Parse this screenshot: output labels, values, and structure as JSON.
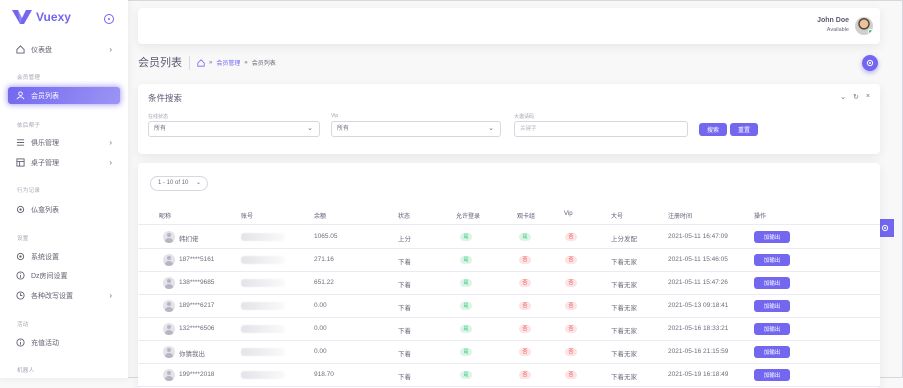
{
  "app": {
    "brand": "Vuexy",
    "accent": "#7367f0",
    "success": "#28c76f",
    "danger": "#ea5455"
  },
  "sidebar": {
    "sections": [
      "会员管理",
      "依后帮子",
      "行为记录",
      "设置",
      "活动",
      "机器人"
    ],
    "items": [
      {
        "label": "仪表盘",
        "icon": "home-icon",
        "active": false,
        "has_submenu": true
      },
      {
        "label": "会员列表",
        "icon": "user-icon",
        "active": true,
        "has_submenu": false
      },
      {
        "label": "俱乐管理",
        "icon": "list-icon",
        "active": false,
        "has_submenu": true
      },
      {
        "label": "桌子管理",
        "icon": "layout-icon",
        "active": false,
        "has_submenu": true
      },
      {
        "label": "仏龛列表",
        "icon": "settings-icon",
        "active": false,
        "has_submenu": false
      },
      {
        "label": "系统设置",
        "icon": "gear-icon",
        "active": false,
        "has_submenu": false
      },
      {
        "label": "Dz房间设置",
        "icon": "info-icon",
        "active": false,
        "has_submenu": false
      },
      {
        "label": "各种改写设置",
        "icon": "clock-icon",
        "active": false,
        "has_submenu": true
      },
      {
        "label": "充值活动",
        "icon": "info-icon",
        "active": false,
        "has_submenu": false
      }
    ]
  },
  "navbar": {
    "user_name": "John Doe",
    "user_status": "Available"
  },
  "header": {
    "title": "会员列表",
    "breadcrumb": [
      "会员管理",
      "会员列表"
    ]
  },
  "filter": {
    "title": "条件搜索",
    "fields": [
      {
        "label": "在线状态",
        "value": "所有"
      },
      {
        "label": "Vip",
        "value": "所有"
      },
      {
        "label": "大邀请码",
        "placeholder": "关键字"
      }
    ],
    "search_label": "搜索",
    "reset_label": "重置"
  },
  "table": {
    "pager": "1 - 10 of 10",
    "columns": [
      "昵称",
      "账号",
      "余额",
      "状态",
      "允许登录",
      "观卡组",
      "Vip",
      "大号",
      "注册时间",
      "操作"
    ],
    "rows": [
      {
        "nick": "韩扪佬",
        "balance": "1065.05",
        "status": "上分",
        "allow": "是",
        "allow_ok": true,
        "card": "是",
        "card_ok": true,
        "vip": "否",
        "main": "上分发配",
        "time": "2021-05-11 16:47:09",
        "action": "加输出"
      },
      {
        "nick": "187****5161",
        "balance": "271.16",
        "status": "下着",
        "allow": "是",
        "allow_ok": true,
        "card": "否",
        "card_ok": false,
        "vip": "否",
        "main": "下着无家",
        "time": "2021-05-11 15:46:05",
        "action": "加输出"
      },
      {
        "nick": "138****9685",
        "balance": "651.22",
        "status": "下着",
        "allow": "是",
        "allow_ok": true,
        "card": "否",
        "card_ok": false,
        "vip": "否",
        "main": "下着无家",
        "time": "2021-05-11 15:47:26",
        "action": "加输出"
      },
      {
        "nick": "189****6217",
        "balance": "0.00",
        "status": "下着",
        "allow": "是",
        "allow_ok": true,
        "card": "否",
        "card_ok": false,
        "vip": "否",
        "main": "下着无家",
        "time": "2021-05-13 09:18:41",
        "action": "加输出"
      },
      {
        "nick": "132****6506",
        "balance": "0.00",
        "status": "下着",
        "allow": "是",
        "allow_ok": true,
        "card": "否",
        "card_ok": false,
        "vip": "否",
        "main": "下着无家",
        "time": "2021-05-16 18:33:21",
        "action": "加输出"
      },
      {
        "nick": "你猜我出",
        "balance": "0.00",
        "status": "下着",
        "allow": "是",
        "allow_ok": true,
        "card": "否",
        "card_ok": false,
        "vip": "否",
        "main": "下着无家",
        "time": "2021-05-16 21:15:59",
        "action": "加输出"
      },
      {
        "nick": "199****2018",
        "balance": "918.70",
        "status": "下着",
        "allow": "是",
        "allow_ok": true,
        "card": "否",
        "card_ok": false,
        "vip": "否",
        "main": "下着无家",
        "time": "2021-05-19 16:18:49",
        "action": "加输出"
      }
    ]
  }
}
